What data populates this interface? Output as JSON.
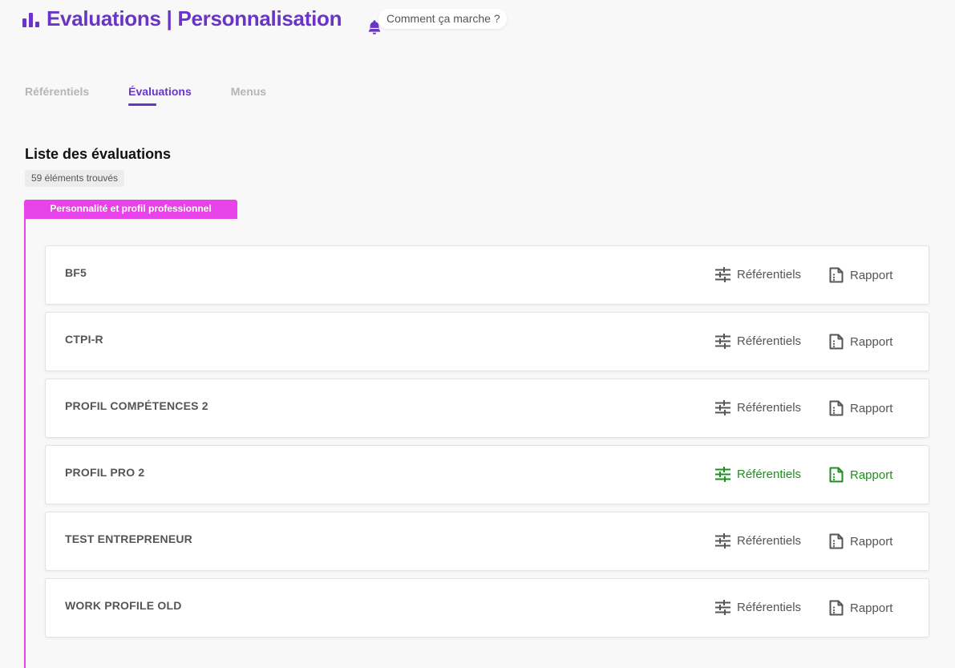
{
  "header": {
    "title": "Evaluations | Personnalisation",
    "help_text": "Comment ça marche ?",
    "brand_color": "#6a35c7"
  },
  "tabs": [
    {
      "label": "Référentiels",
      "active": false
    },
    {
      "label": "Évaluations",
      "active": true
    },
    {
      "label": "Menus",
      "active": false
    }
  ],
  "list": {
    "title": "Liste des évaluations",
    "count_text": "59 éléments trouvés",
    "category": {
      "label": "Personnalité et profil professionnel",
      "color": "#e843e8"
    },
    "items": [
      {
        "name": "BF5",
        "referentiels_label": "Référentiels",
        "rapport_label": "Rapport",
        "highlighted": false
      },
      {
        "name": "CTPI-R",
        "referentiels_label": "Référentiels",
        "rapport_label": "Rapport",
        "highlighted": false
      },
      {
        "name": "PROFIL COMPÉTENCES 2",
        "referentiels_label": "Référentiels",
        "rapport_label": "Rapport",
        "highlighted": false
      },
      {
        "name": "PROFIL PRO 2",
        "referentiels_label": "Référentiels",
        "rapport_label": "Rapport",
        "highlighted": true
      },
      {
        "name": "TEST ENTREPRENEUR",
        "referentiels_label": "Référentiels",
        "rapport_label": "Rapport",
        "highlighted": false
      },
      {
        "name": "WORK PROFILE OLD",
        "referentiels_label": "Référentiels",
        "rapport_label": "Rapport",
        "highlighted": false
      }
    ]
  },
  "colors": {
    "highlight_action": "#1e8f1e",
    "inactive_tab": "#b5b5b5"
  },
  "icons": {
    "logo": "bar-chart-icon",
    "help": "bell-icon",
    "referentiels": "sliders-icon",
    "rapport": "document-icon"
  }
}
